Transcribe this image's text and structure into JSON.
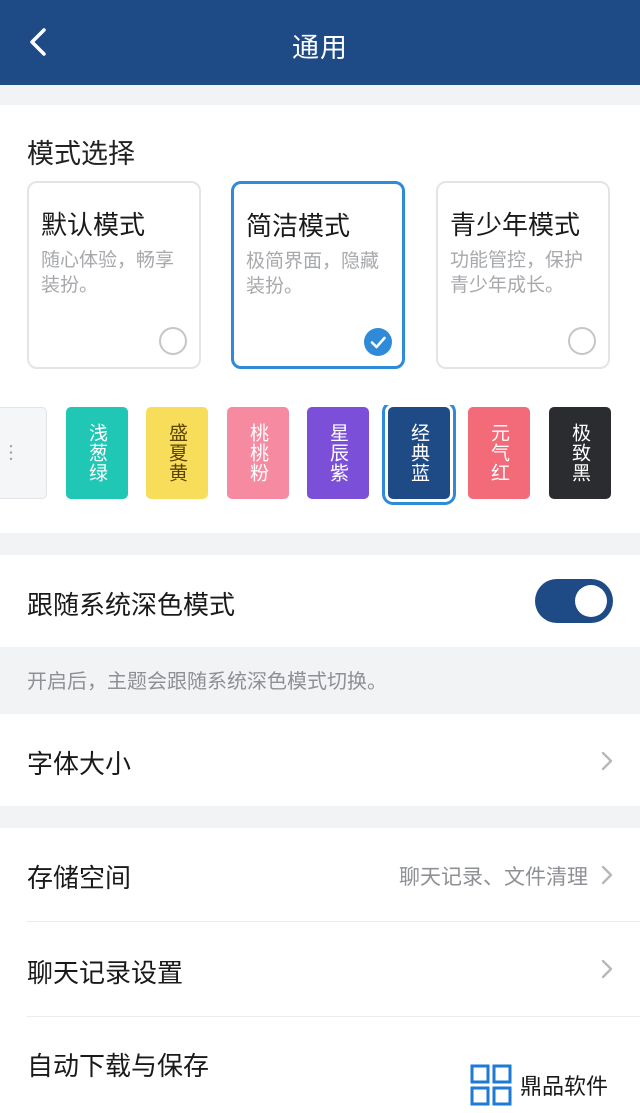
{
  "header": {
    "title": "通用",
    "back_icon": "chevron-left-icon"
  },
  "mode_section": {
    "title": "模式选择",
    "modes": [
      {
        "name": "默认模式",
        "desc": "随心体验，畅享装扮。",
        "selected": false
      },
      {
        "name": "简洁模式",
        "desc": "极简界面，隐藏装扮。",
        "selected": true
      },
      {
        "name": "青少年模式",
        "desc": "功能管控，保护青少年成长。",
        "selected": false
      }
    ],
    "themes": [
      {
        "label": "…",
        "color": "#f5f6f8"
      },
      {
        "label": "浅葱绿",
        "color": "#1fc7b4"
      },
      {
        "label": "盛夏黄",
        "color": "#f7dd5a"
      },
      {
        "label": "桃桃粉",
        "color": "#f68aa0"
      },
      {
        "label": "星辰紫",
        "color": "#7c4fd8"
      },
      {
        "label": "经典蓝",
        "color": "#1e4a86",
        "selected": true
      },
      {
        "label": "元气红",
        "color": "#f36b78"
      },
      {
        "label": "极致黑",
        "color": "#2b2c30"
      }
    ]
  },
  "dark_mode": {
    "label": "跟随系统深色模式",
    "enabled": true,
    "hint": "开启后，主题会跟随系统深色模式切换。"
  },
  "font_size": {
    "label": "字体大小"
  },
  "storage": {
    "label": "存储空间",
    "extra": "聊天记录、文件清理"
  },
  "chat_history": {
    "label": "聊天记录设置"
  },
  "auto_download": {
    "label": "自动下载与保存"
  },
  "watermark": {
    "text": "鼎品软件"
  },
  "colors": {
    "header": "#1e4a86",
    "accent": "#2f8bd8",
    "background": "#f2f3f5"
  }
}
